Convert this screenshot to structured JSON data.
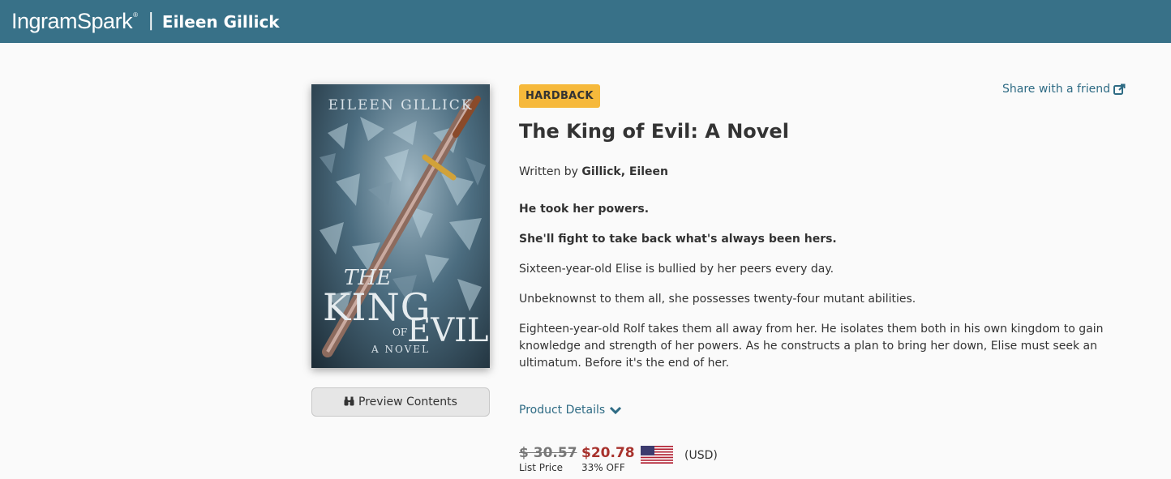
{
  "header": {
    "brand": "IngramSpark",
    "brand_mark": "®",
    "separator": "|",
    "publisher": "Eileen Gillick"
  },
  "cover": {
    "author": "EILEEN GILLICK",
    "title_the": "THE",
    "title_king": "KING",
    "title_of": "OF",
    "title_evil": "EVIL",
    "subtitle": "A NOVEL"
  },
  "preview": {
    "label": "Preview Contents",
    "icon": "binoculars-icon"
  },
  "book": {
    "format_badge": "HARDBACK",
    "share_label": "Share with a friend",
    "title": "The King of Evil: A Novel",
    "written_by_prefix": "Written by",
    "author": "Gillick, Eileen",
    "description": [
      "He took her powers.",
      "She'll fight to take back what's always been hers.",
      "Sixteen-year-old Elise is bullied by her peers every day.",
      "Unbeknownst to them all, she possesses twenty-four mutant abilities.",
      "Eighteen-year-old Rolf takes them all away from her. He isolates them both in his own kingdom to gain knowledge and strength of her powers. As he constructs a plan to bring her down, Elise must seek an ultimatum. Before it's the end of her."
    ],
    "product_details_label": "Product Details"
  },
  "pricing": {
    "list_price": "$ 30.57",
    "list_label": "List Price",
    "sale_price": "$20.78",
    "discount_label": "33% OFF",
    "currency": "(USD)",
    "flag": "us-flag-icon"
  },
  "colors": {
    "header_bg": "#387188",
    "badge_bg": "#f6b93b",
    "link": "#2e6b84",
    "sale_price": "#a8322d"
  }
}
